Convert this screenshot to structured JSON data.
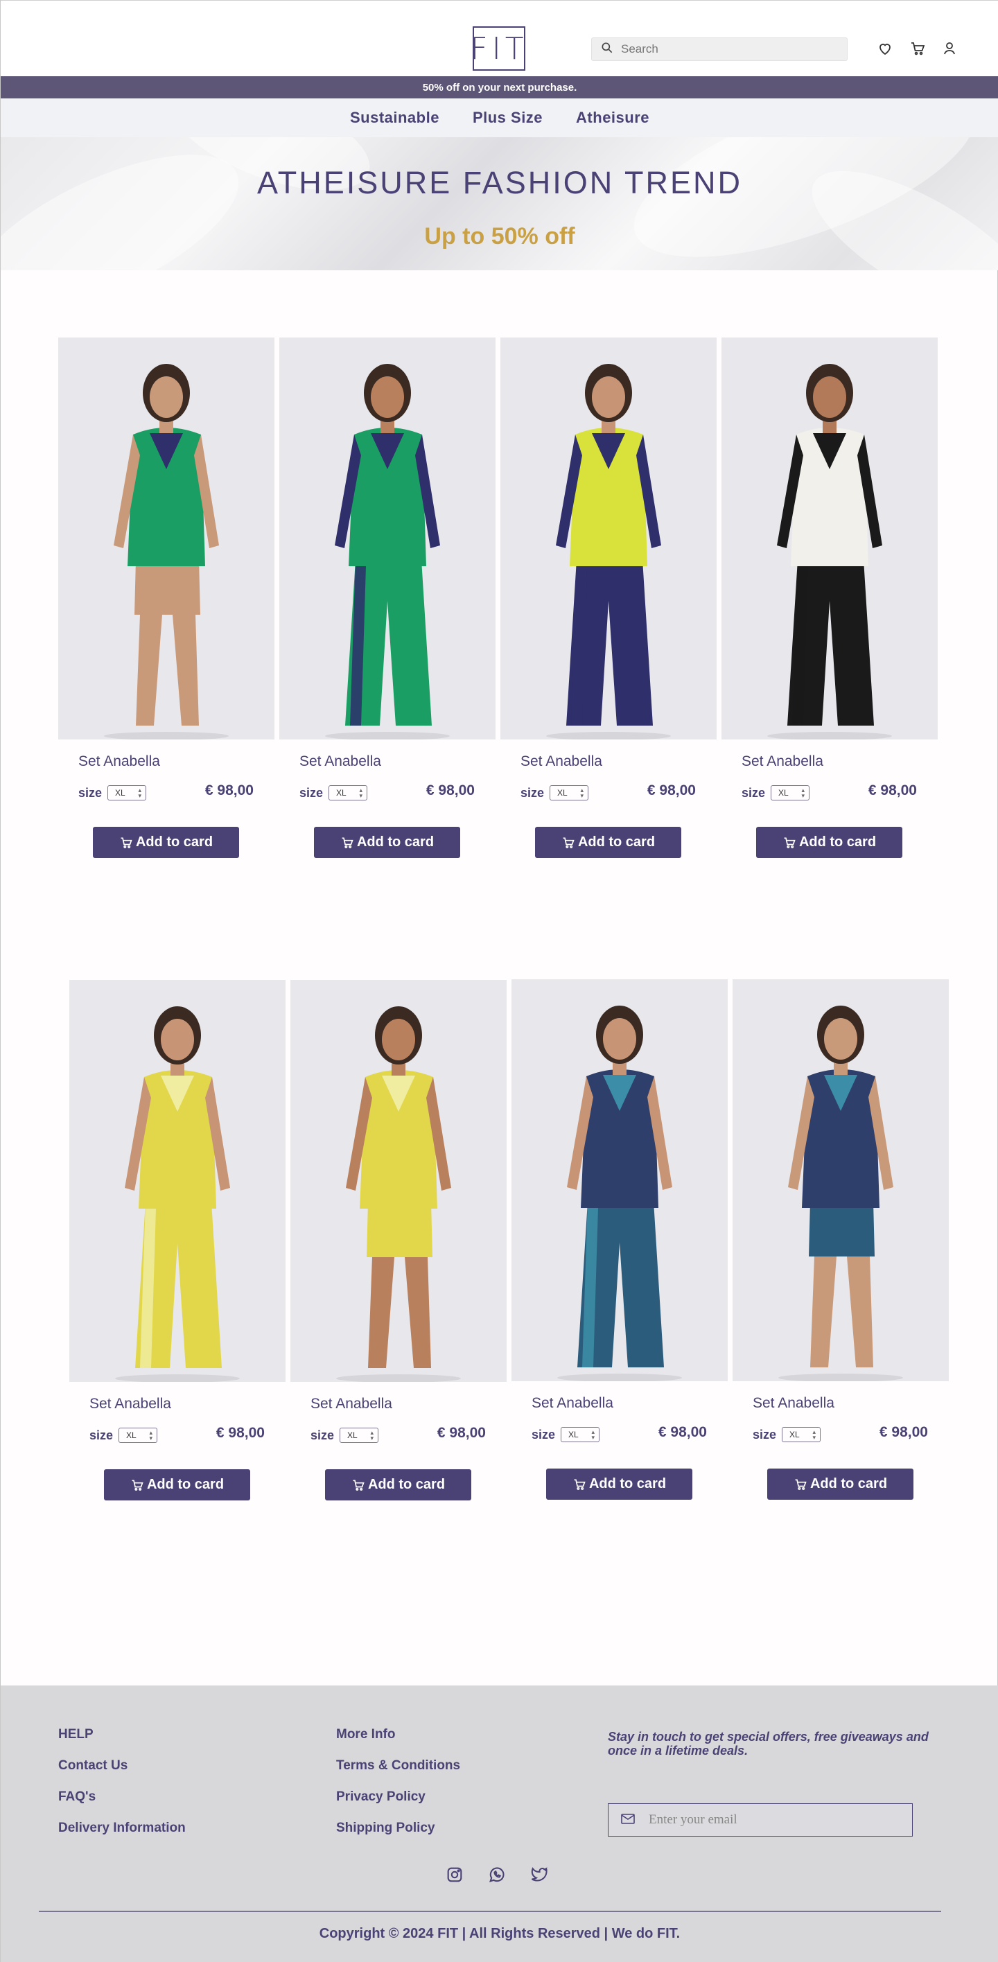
{
  "header": {
    "logo": "FIT",
    "search_placeholder": "Search",
    "icons": [
      "heart-icon",
      "cart-icon",
      "user-icon"
    ]
  },
  "promo": "50% off on your next purchase.",
  "nav": [
    "Sustainable",
    "Plus Size",
    "Atheisure"
  ],
  "hero": {
    "title": "ATHEISURE  FASHION TREND",
    "subtitle": "Up to 50% off"
  },
  "products": [
    {
      "name": "Set Anabella",
      "size_label": "size",
      "size": "XL",
      "price": "€ 98,00",
      "button": "Add to card",
      "colors": {
        "top": "#1a9e63",
        "accent": "#2e2f6b",
        "bottom": "skin"
      }
    },
    {
      "name": "Set Anabella",
      "size_label": "size",
      "size": "XL",
      "price": "€ 98,00",
      "button": "Add to card",
      "colors": {
        "top": "#1a9e63",
        "accent": "#2e2f6b",
        "bottom": "#1a9e63"
      }
    },
    {
      "name": "Set Anabella",
      "size_label": "size",
      "size": "XL",
      "price": "€ 98,00",
      "button": "Add to card",
      "colors": {
        "top": "#d9e23a",
        "accent": "#2e2f6b",
        "bottom": "#2e2f6b"
      }
    },
    {
      "name": "Set Anabella",
      "size_label": "size",
      "size": "XL",
      "price": "€ 98,00",
      "button": "Add to card",
      "colors": {
        "top": "#f2f0ea",
        "accent": "#1a1a1a",
        "bottom": "#1a1a1a"
      }
    },
    {
      "name": "Set Anabella",
      "size_label": "size",
      "size": "XL",
      "price": "€ 98,00",
      "button": "Add to card",
      "colors": {
        "top": "#e2d74a",
        "accent": "#f0eca0",
        "bottom": "#e2d74a"
      }
    },
    {
      "name": "Set Anabella",
      "size_label": "size",
      "size": "XL",
      "price": "€ 98,00",
      "button": "Add to card",
      "colors": {
        "top": "#e2d74a",
        "accent": "#f0eca0",
        "bottom": "#e2d74a"
      }
    },
    {
      "name": "Set Anabella",
      "size_label": "size",
      "size": "XL",
      "price": "€ 98,00",
      "button": "Add to card",
      "colors": {
        "top": "#2f3f6b",
        "accent": "#3c8ea8",
        "bottom": "#2c5c7c"
      }
    },
    {
      "name": "Set Anabella",
      "size_label": "size",
      "size": "XL",
      "price": "€ 98,00",
      "button": "Add to card",
      "colors": {
        "top": "#2f3f6b",
        "accent": "#3c8ea8",
        "bottom": "#2c5c7c"
      }
    }
  ],
  "footer": {
    "help": [
      "HELP",
      "Contact Us",
      "FAQ's",
      "Delivery Information"
    ],
    "more": [
      "More Info",
      "Terms & Conditions",
      "Privacy Policy",
      "Shipping Policy"
    ],
    "newsletter": "Stay in touch to get special offers, free giveaways and once in a lifetime deals.",
    "email_placeholder": "Enter your email",
    "socials": [
      "instagram-icon",
      "whatsapp-icon",
      "twitter-icon"
    ],
    "copyright": "Copyright © 2024 FIT | All Rights Reserved |  We do FIT."
  }
}
